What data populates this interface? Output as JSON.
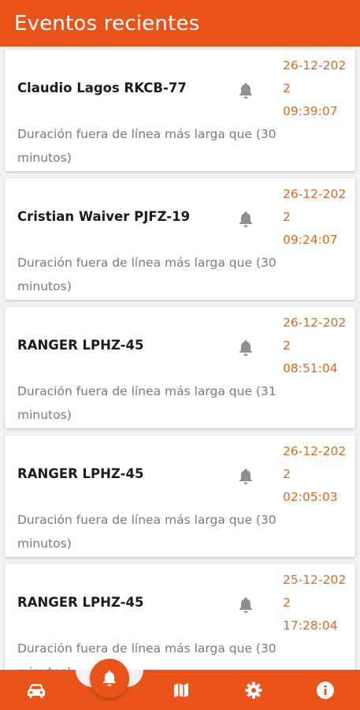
{
  "header": {
    "title": "Eventos recientes"
  },
  "events": [
    {
      "name": "Claudio Lagos RKCB-77",
      "date": "26-12-2022",
      "time": "09:39:07",
      "description": "Duración fuera de línea más larga que (30 minutos)"
    },
    {
      "name": "Cristian Waiver PJFZ-19",
      "date": "26-12-2022",
      "time": "09:24:07",
      "description": "Duración fuera de línea más larga que (30 minutos)"
    },
    {
      "name": "RANGER LPHZ-45",
      "date": "26-12-2022",
      "time": "08:51:04",
      "description": "Duración fuera de línea más larga que (31 minutos)"
    },
    {
      "name": "RANGER LPHZ-45",
      "date": "26-12-2022",
      "time": "02:05:03",
      "description": "Duración fuera de línea más larga que (30 minutos)"
    },
    {
      "name": "RANGER LPHZ-45",
      "date": "25-12-2022",
      "time": "17:28:04",
      "description": "Duración fuera de línea más larga que (30 minutos)"
    }
  ],
  "bottom_nav": {
    "items": [
      {
        "icon": "car-icon"
      },
      {
        "icon": "bell-icon",
        "active": true
      },
      {
        "icon": "map-icon"
      },
      {
        "icon": "gear-icon"
      },
      {
        "icon": "info-icon"
      }
    ]
  },
  "colors": {
    "accent": "#e8541a",
    "date": "#d9691f",
    "background": "#f2f2f2"
  }
}
